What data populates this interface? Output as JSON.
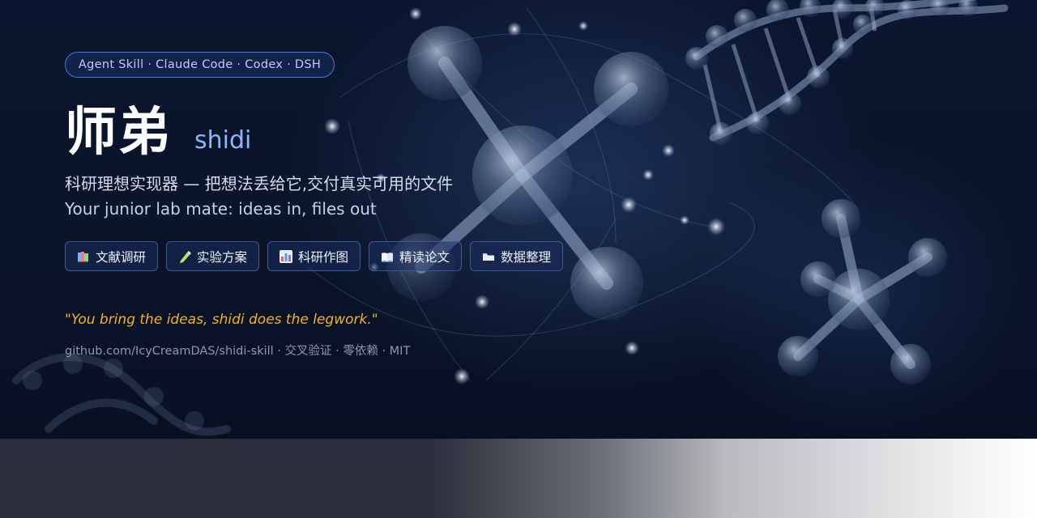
{
  "tag_pill": "Agent Skill · Claude Code · Codex · DSH",
  "title": {
    "cn": "师弟",
    "en": "shidi"
  },
  "subtitle": {
    "cn": "科研理想实现器 — 把想法丢给它,交付真实可用的文件",
    "en": "Your junior lab mate: ideas in, files out"
  },
  "chips": [
    {
      "label": "文献调研",
      "icon": "books-icon"
    },
    {
      "label": "实验方案",
      "icon": "pen-icon"
    },
    {
      "label": "科研作图",
      "icon": "bar-chart-icon"
    },
    {
      "label": "精读论文",
      "icon": "open-book-icon"
    },
    {
      "label": "数据整理",
      "icon": "folder-icon"
    }
  ],
  "quote": "\"You bring the ideas, shidi does the legwork.\"",
  "footer": "github.com/IcyCreamDAS/shidi-skill · 交叉验证 · 零依赖 · MIT",
  "colors": {
    "background": "#0a1429",
    "accent": "#8fb6f6",
    "quote": "#f2b422",
    "pill_border": "#4a78d8"
  }
}
